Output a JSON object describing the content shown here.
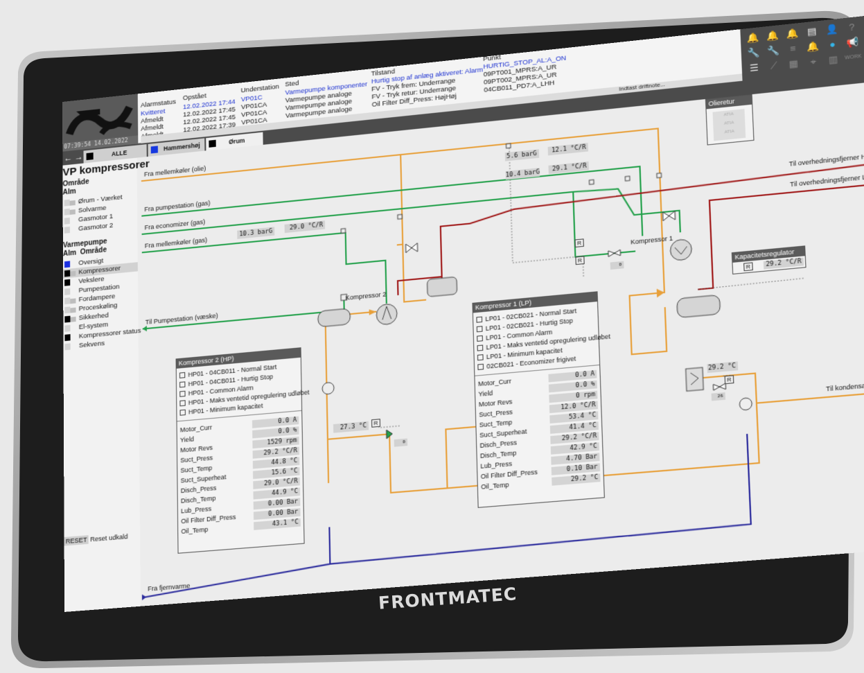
{
  "brand": "FRONTMATEC",
  "clock": "07:39:54 14.02.2022",
  "alarm_headers": {
    "alarmstatus": "Alarmstatus",
    "opstaet": "Opstået",
    "understation": "Understation",
    "sted": "Sted",
    "tilstand": "Tilstand",
    "punkt": "Punkt"
  },
  "alarms": [
    {
      "status": "Kvitteret",
      "time": "12.02.2022 17:44",
      "station": "VP01C",
      "place": "Varmepumpe komponenter",
      "state": "Hurtig stop af anlæg aktiveret: Alarm",
      "point": "HURTIG_STOP_AL:A_ON"
    },
    {
      "status": "Afmeldt",
      "time": "12.02.2022 17:45",
      "station": "VP01CA",
      "place": "Varmepumpe analoge",
      "state": "FV - Tryk frem: Underrange",
      "point": "09PT001_MPRS:A_UR"
    },
    {
      "status": "Afmeldt",
      "time": "12.02.2022 17:45",
      "station": "VP01CA",
      "place": "Varmepumpe analoge",
      "state": "FV - Tryk retur: Underrange",
      "point": "09PT002_MPRS:A_UR"
    },
    {
      "status": "Afmeldt",
      "time": "12.02.2022 17:39",
      "station": "VP01CA",
      "place": "Varmepumpe analoge",
      "state": "Oil Filter Diff_Press: HøjHøj",
      "point": "04CB011_PD7:A_LHH"
    }
  ],
  "note_placeholder": "Indtast driftnote...",
  "tabs": [
    "ALLE",
    "Hammershøj",
    "Ørum"
  ],
  "work_label": "WORK",
  "page_title": "VP kompressorer",
  "left": {
    "omraade": "Område",
    "alm": "Alm",
    "omraade_items": [
      "Ørum - Værket",
      "Solvarme",
      "Gasmotor 1",
      "Gasmotor 2"
    ],
    "varmepumpe": "Varmepumpe",
    "alm_omraade": "Alm  Område",
    "vp_items": [
      "Oversigt",
      "Kompressorer",
      "Vekslere",
      "Pumpestation",
      "Fordampere",
      "Proceskøling",
      "Sikkerhed",
      "El-system",
      "Kompressorer status",
      "Sekvens"
    ],
    "reset_btn": "RESET",
    "reset_label": "Reset udkald"
  },
  "diagram": {
    "fra_mellemkoler_olie": "Fra mellemkøler (olie)",
    "fra_pumpestation": "Fra pumpestation (gas)",
    "fra_economizer": "Fra economizer (gas)",
    "fra_mellemkoler_gas": "Fra mellemkøler (gas)",
    "til_pumpestation": "Til Pumpestation (væske)",
    "fra_fjernvarme": "Fra fjernvarme",
    "til_hp": "Til overhedningsfjerner HP",
    "til_lp": "Til overhedningsfjerner LP",
    "til_kondensator": "Til kondensator",
    "kompressor2": "Kompressor 2",
    "kompressor1": "Kompressor 1",
    "oilereturn_title": "Olieretur",
    "oilereturn_items": [
      "ATIA",
      "ATIA",
      "ATIA"
    ],
    "kapacitet_title": "Kapacitetsregulator",
    "kapacitet_value": "29.2 °C/R",
    "r_label": "R",
    "press_top1": "5.6 barG",
    "temp_top1": "12.1 °C/R",
    "press_top2": "10.4 barG",
    "temp_top2": "29.1 °C/R",
    "econ_press": "10.3 barG",
    "econ_temp": "29.0 °C/R",
    "temp_left": "27.3 °C",
    "valve_left": "0",
    "valve_mid": "0",
    "temp_right": "29.2 °C",
    "valve_right": "26"
  },
  "k2": {
    "title": "Kompressor 2 (HP)",
    "status": [
      "HP01 - 04CB011 - Normal Start",
      "HP01 - 04CB011 - Hurtig Stop",
      "HP01 - Common Alarm",
      "HP01 - Maks ventetid opregulering udløbet",
      "HP01 - Minimum kapacitet"
    ],
    "metrics": [
      {
        "name": "Motor_Curr",
        "value": "0.0 A"
      },
      {
        "name": "Yield",
        "value": "0.0 %"
      },
      {
        "name": "Motor Revs",
        "value": "1529 rpm"
      },
      {
        "name": "Suct_Press",
        "value": "29.2 °C/R"
      },
      {
        "name": "Suct_Temp",
        "value": "44.8 °C"
      },
      {
        "name": "Suct_Superheat",
        "value": "15.6 °C"
      },
      {
        "name": "Disch_Press",
        "value": "29.0 °C/R"
      },
      {
        "name": "Disch_Temp",
        "value": "44.9 °C"
      },
      {
        "name": "Lub_Press",
        "value": "0.00 Bar"
      },
      {
        "name": "Oil Filter Diff_Press",
        "value": "0.00 Bar"
      },
      {
        "name": "Oil_Temp",
        "value": "43.1 °C"
      }
    ]
  },
  "k1": {
    "title": "Kompressor 1 (LP)",
    "status": [
      "LP01 - 02CB021 - Normal Start",
      "LP01 - 02CB021 - Hurtig Stop",
      "LP01 - Common Alarm",
      "LP01 - Maks ventetid opregulering udløbet",
      "LP01 - Minimum kapacitet",
      "02CB021 - Economizer frigivet"
    ],
    "metrics": [
      {
        "name": "Motor_Curr",
        "value": "0.0 A"
      },
      {
        "name": "Yield",
        "value": "0.0 %"
      },
      {
        "name": "Motor Revs",
        "value": "0 rpm"
      },
      {
        "name": "Suct_Press",
        "value": "12.0 °C/R"
      },
      {
        "name": "Suct_Temp",
        "value": "53.4 °C"
      },
      {
        "name": "Suct_Superheat",
        "value": "41.4 °C"
      },
      {
        "name": "Disch_Press",
        "value": "29.2 °C/R"
      },
      {
        "name": "Disch_Temp",
        "value": "42.9 °C"
      },
      {
        "name": "Lub_Press",
        "value": "4.70 Bar"
      },
      {
        "name": "Oil Filter Diff_Press",
        "value": "0.10 Bar"
      },
      {
        "name": "Oil_Temp",
        "value": "29.2 °C"
      }
    ]
  },
  "colors": {
    "oil": "#e8a03a",
    "gas_green": "#22a04a",
    "hot_red": "#a01818",
    "water_blue": "#2a2a9c",
    "alarm_blue": "#1a2fd0"
  }
}
